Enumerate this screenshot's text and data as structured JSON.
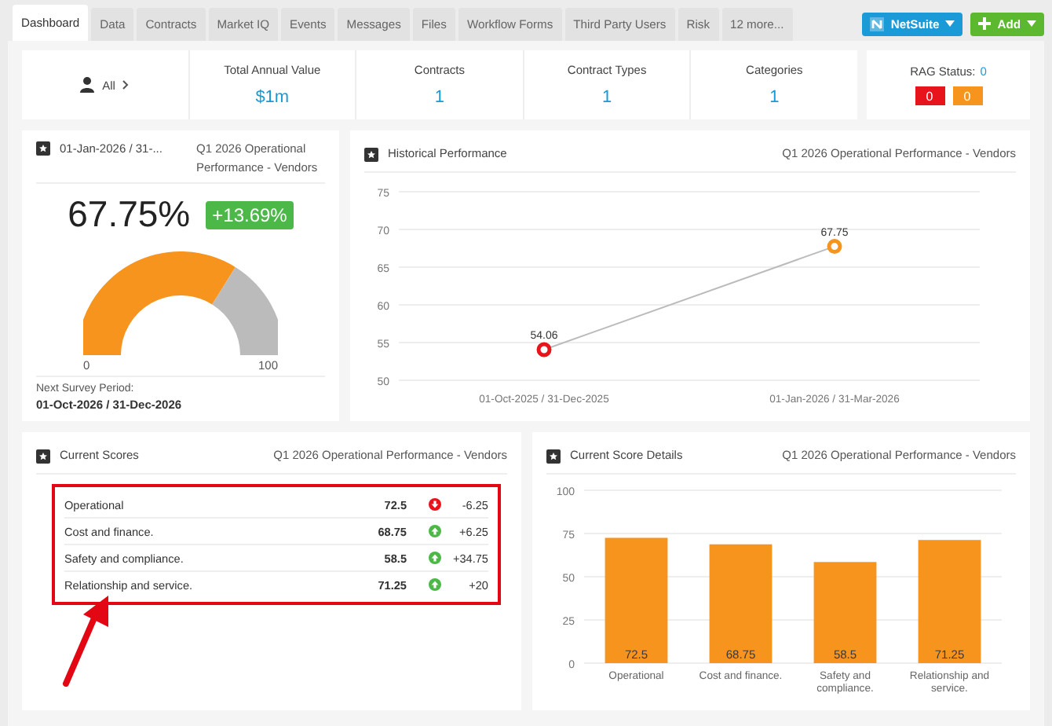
{
  "tabs": [
    {
      "label": "Dashboard",
      "selected": true
    },
    {
      "label": "Data",
      "selected": false
    },
    {
      "label": "Contracts",
      "selected": false
    },
    {
      "label": "Market IQ",
      "selected": false
    },
    {
      "label": "Events",
      "selected": false
    },
    {
      "label": "Messages",
      "selected": false
    },
    {
      "label": "Files",
      "selected": false
    },
    {
      "label": "Workflow Forms",
      "selected": false
    },
    {
      "label": "Third Party Users",
      "selected": false
    },
    {
      "label": "Risk",
      "selected": false
    },
    {
      "label": "12 more...",
      "selected": false
    }
  ],
  "actions": [
    {
      "label": "NetSuite",
      "color": "#1a9ad6"
    },
    {
      "label": "Add",
      "color": "#5cb82e"
    }
  ],
  "filter": {
    "label": "All"
  },
  "stats": [
    {
      "label": "Total Annual Value",
      "value": "$1m"
    },
    {
      "label": "Contracts",
      "value": "1"
    },
    {
      "label": "Contract Types",
      "value": "1"
    },
    {
      "label": "Categories",
      "value": "1"
    }
  ],
  "rag": {
    "label": "RAG Status:",
    "value": "0",
    "badges": [
      {
        "value": "0",
        "color": "#e8141c"
      },
      {
        "value": "0",
        "color": "#f7941d"
      }
    ]
  },
  "score_card": {
    "period": "01-Jan-2026 / 31-...",
    "survey": "Q1 2026 Operational Performance - Vendors",
    "score": "67.75%",
    "change": "+13.69%",
    "gauge": {
      "min": "0",
      "max": "100"
    },
    "next_label": "Next Survey Period:",
    "next_period": "01-Oct-2026 / 31-Dec-2026"
  },
  "history": {
    "title": "Historical Performance",
    "survey": "Q1 2026 Operational Performance - Vendors",
    "chart_data": {
      "type": "line",
      "categories": [
        "01-Oct-2025 / 31-Dec-2025",
        "01-Jan-2026 / 31-Mar-2026"
      ],
      "series": [
        {
          "color": "#bbbbbb",
          "marker": true,
          "values": [
            54.06,
            67.75
          ]
        }
      ],
      "ylim": [
        50,
        75
      ],
      "yticks": [
        50,
        55,
        60,
        65,
        70,
        75
      ],
      "grid": true,
      "data_labels": true
    }
  },
  "current_scores": {
    "title": "Current Scores",
    "survey": "Q1 2026 Operational Performance - Vendors",
    "rows": [
      {
        "name": "Operational",
        "score": "72.5",
        "change": "-6.25",
        "kind": "down"
      },
      {
        "name": "Cost and finance.",
        "score": "68.75",
        "change": "+6.25",
        "kind": "up"
      },
      {
        "name": "Safety and compliance.",
        "score": "58.5",
        "change": "+34.75",
        "kind": "up"
      },
      {
        "name": "Relationship and service.",
        "score": "71.25",
        "change": "+20",
        "kind": "up"
      }
    ]
  },
  "score_details": {
    "title": "Current Score Details",
    "survey": "Q1 2026 Operational Performance - Vendors",
    "chart_data": {
      "type": "bar",
      "categories": [
        "Operational",
        "Cost and finance.",
        "Safety and compliance.",
        "Relationship and service."
      ],
      "series": [
        {
          "color": "#f7941d",
          "values": [
            72.5,
            68.75,
            58.5,
            71.25
          ]
        }
      ],
      "ylim": [
        0,
        100
      ],
      "yticks": [
        0,
        25,
        50,
        75,
        100
      ],
      "grid": true,
      "data_labels": true
    }
  }
}
